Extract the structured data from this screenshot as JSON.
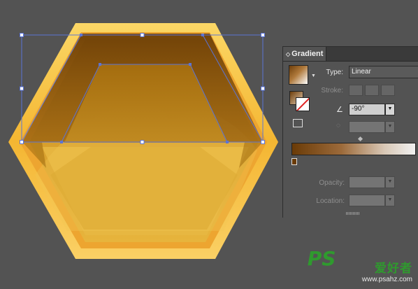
{
  "gradient_panel": {
    "tab_title": "Gradient",
    "tab_arrows": "◇",
    "type_label": "Type:",
    "type_value": "Linear",
    "stroke_label": "Stroke:",
    "angle_value": "-90°",
    "opacity_label": "Opacity:",
    "location_label": "Location:",
    "gradient_colors": [
      "#6a3b07",
      "#f0f0f0"
    ]
  },
  "watermark": {
    "logo": "PS",
    "text": "爱好者",
    "url": "www.psahz.com"
  },
  "colors": {
    "background": "#535353",
    "selection_blue": "#4a67c8",
    "honey_light": "#f7c540",
    "honey_dark": "#8a5a08"
  }
}
